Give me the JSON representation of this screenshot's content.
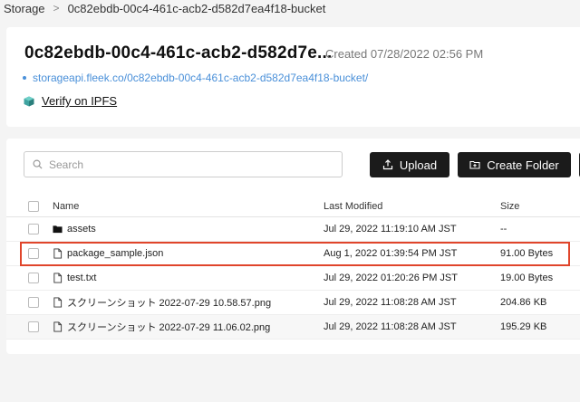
{
  "breadcrumb": {
    "root": "Storage",
    "current": "0c82ebdb-00c4-461c-acb2-d582d7ea4f18-bucket",
    "separator": ">"
  },
  "bucket": {
    "title": "0c82ebdb-00c4-461c-acb2-d582d7e...",
    "created": "Created 07/28/2022 02:56 PM",
    "url": "storageapi.fleek.co/0c82ebdb-00c4-461c-acb2-d582d7ea4f18-bucket/",
    "verify_label": "Verify on IPFS"
  },
  "toolbar": {
    "search_placeholder": "Search",
    "upload_label": "Upload",
    "create_folder_label": "Create Folder"
  },
  "table": {
    "headers": {
      "name": "Name",
      "modified": "Last Modified",
      "size": "Size"
    },
    "rows": [
      {
        "type": "folder",
        "name": "assets",
        "modified": "Jul 29, 2022 11:19:10 AM JST",
        "size": "--"
      },
      {
        "type": "file",
        "name": "package_sample.json",
        "modified": "Aug 1, 2022 01:39:54 PM JST",
        "size": "91.00 Bytes"
      },
      {
        "type": "file",
        "name": "test.txt",
        "modified": "Jul 29, 2022 01:20:26 PM JST",
        "size": "19.00 Bytes"
      },
      {
        "type": "file",
        "name": "スクリーンショット 2022-07-29 10.58.57.png",
        "modified": "Jul 29, 2022 11:08:28 AM JST",
        "size": "204.86 KB"
      },
      {
        "type": "file",
        "name": "スクリーンショット 2022-07-29 11.06.02.png",
        "modified": "Jul 29, 2022 11:08:28 AM JST",
        "size": "195.29 KB"
      }
    ]
  },
  "colors": {
    "accent_link": "#4a90d9",
    "button_bg": "#1b1b1b",
    "highlight": "#e0452b"
  }
}
